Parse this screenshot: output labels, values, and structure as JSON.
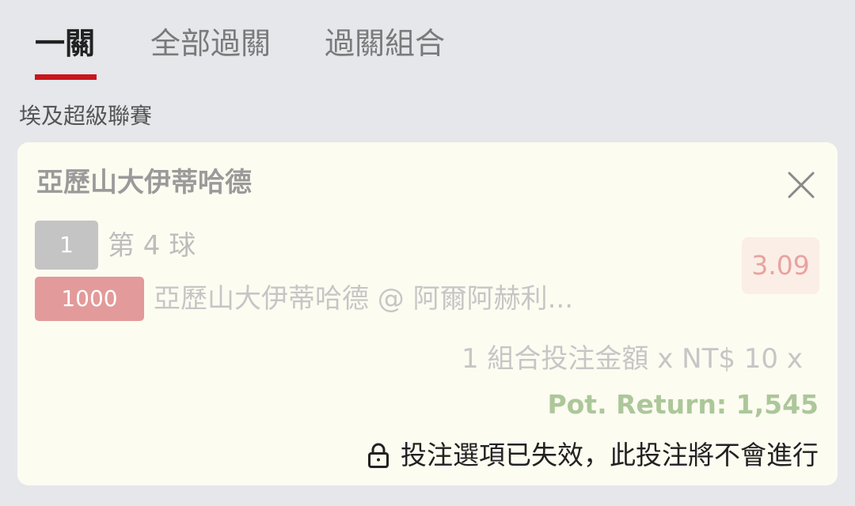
{
  "tabs": [
    {
      "label": "一關",
      "active": true
    },
    {
      "label": "全部過關",
      "active": false
    },
    {
      "label": "過關組合",
      "active": false
    }
  ],
  "league": "埃及超級聯賽",
  "bet": {
    "team": "亞歷山大伊蒂哈德",
    "market_badge": "1",
    "market": "第 4 球",
    "stake_badge": "1000",
    "selection": "亞歷山大伊蒂哈德 @ 阿爾阿赫利...",
    "odds": "3.09",
    "stake_line": "1 組合投注金額 x NT$ 10 x",
    "potential_return": "Pot. Return: 1,545",
    "notice": "投注選項已失效，此投注將不會進行"
  },
  "icons": {
    "close": "close-icon",
    "lock": "lock-icon"
  },
  "colors": {
    "accent": "#c8161d",
    "odds_text": "#e7a3a0",
    "return_text": "#acc79a",
    "card_bg": "#fdfcf1",
    "page_bg": "#e5e7eb"
  }
}
